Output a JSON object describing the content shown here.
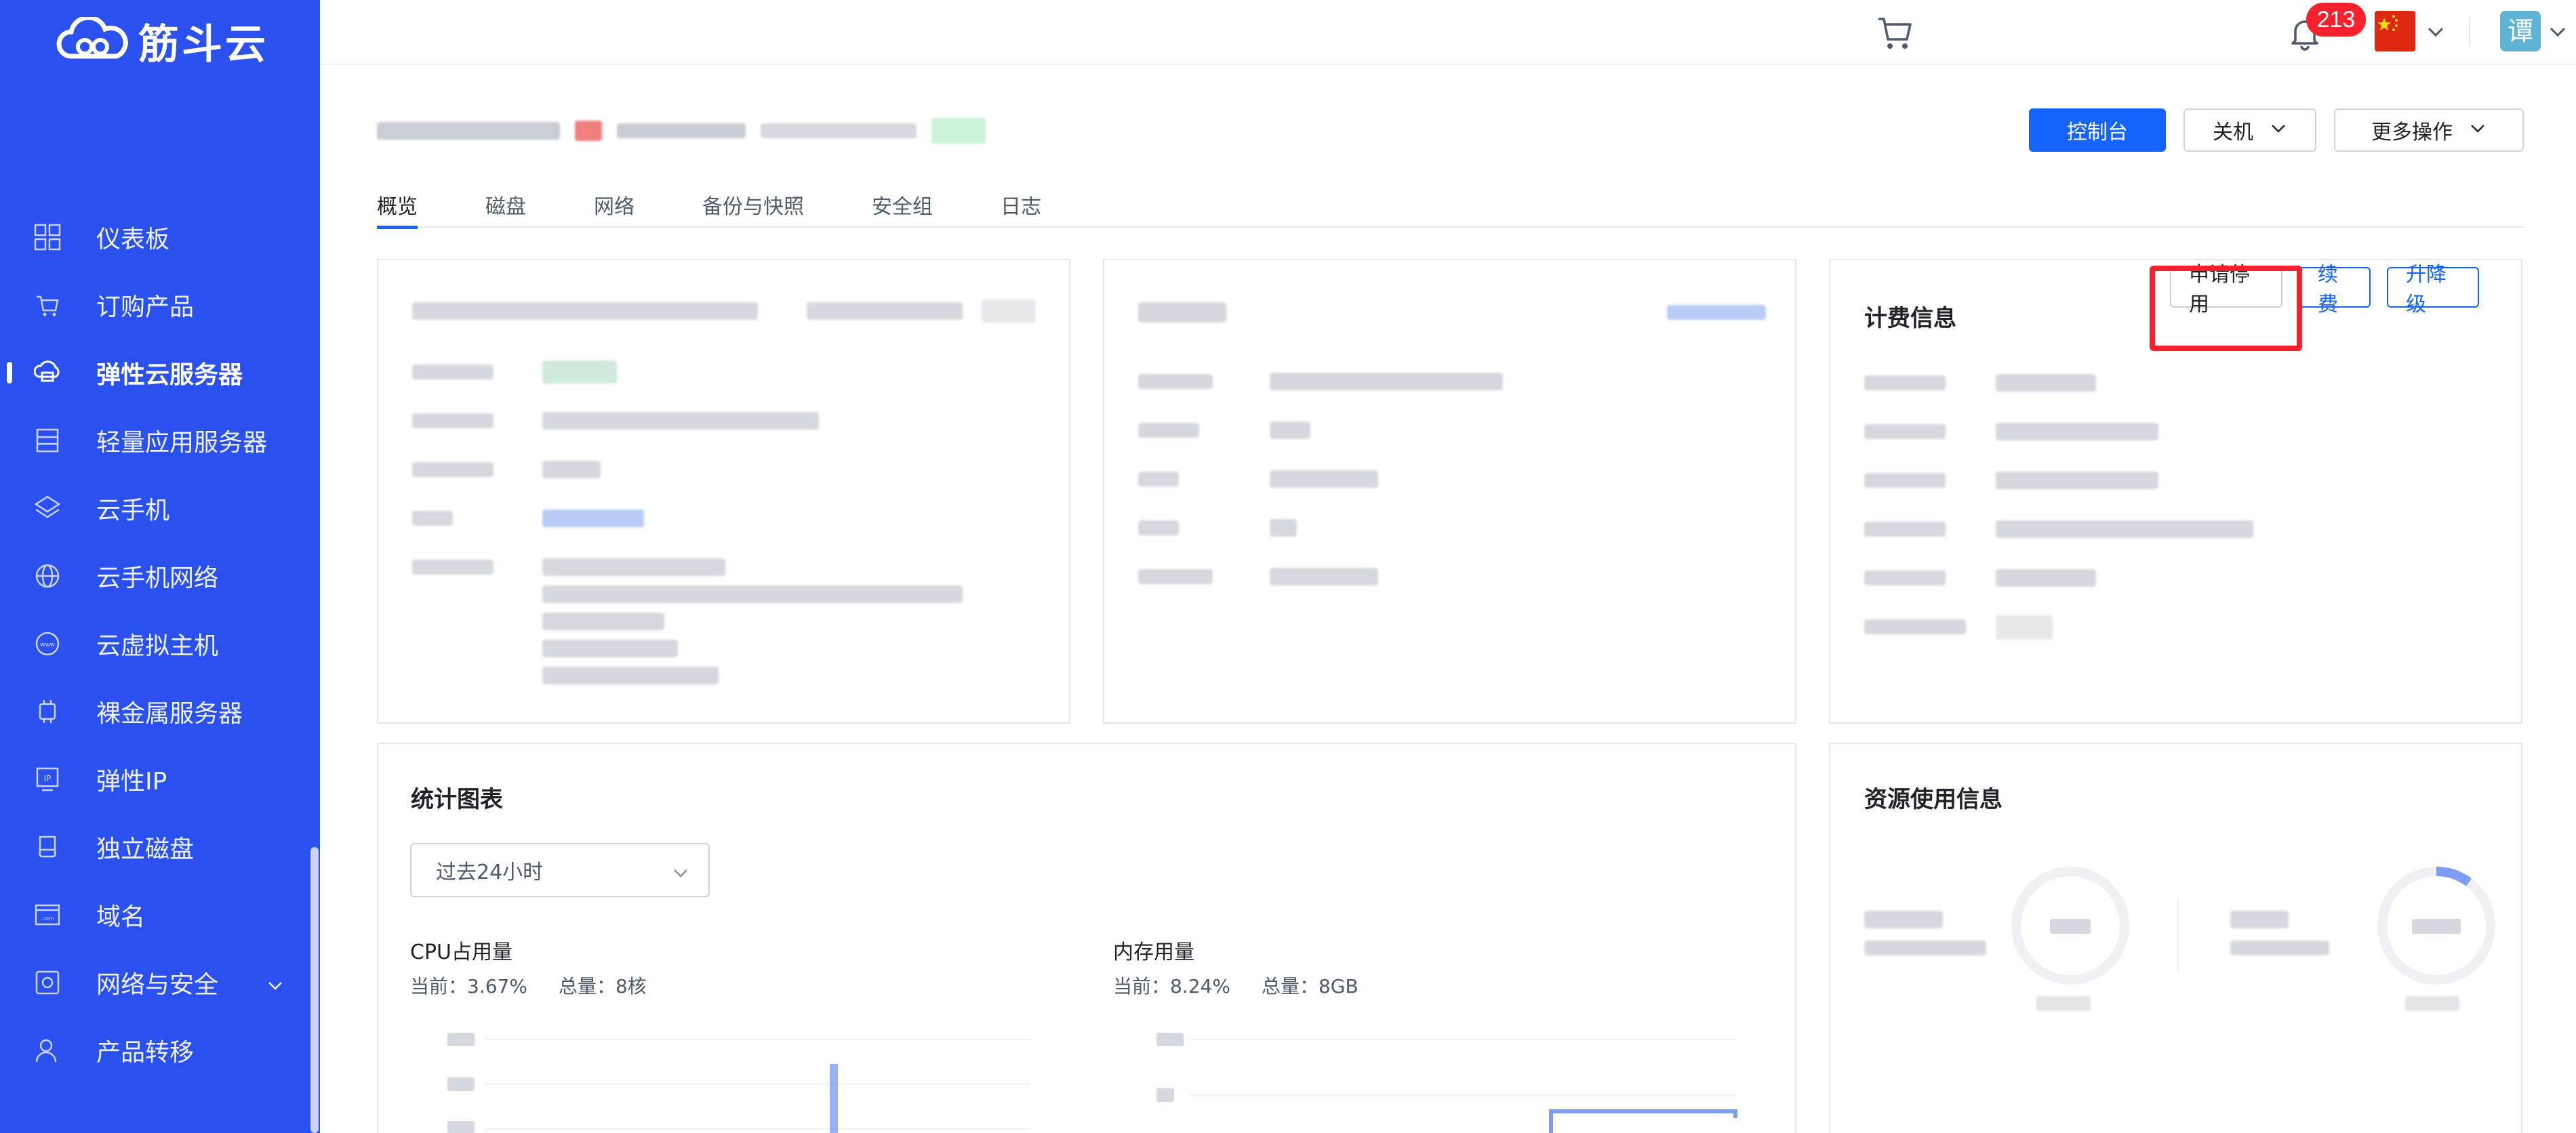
{
  "brand": {
    "name": "筋斗云"
  },
  "sidebar": {
    "items": [
      {
        "label": "仪表板",
        "icon": "grid-icon"
      },
      {
        "label": "订购产品",
        "icon": "cart-icon"
      },
      {
        "label": "弹性云服务器",
        "icon": "cloud-server-icon",
        "active": true
      },
      {
        "label": "轻量应用服务器",
        "icon": "server-icon"
      },
      {
        "label": "云手机",
        "icon": "phone-icon"
      },
      {
        "label": "云手机网络",
        "icon": "globe-icon"
      },
      {
        "label": "云虚拟主机",
        "icon": "www-icon"
      },
      {
        "label": "裸金属服务器",
        "icon": "chip-icon"
      },
      {
        "label": "弹性IP",
        "icon": "ip-icon"
      },
      {
        "label": "独立磁盘",
        "icon": "disk-icon"
      },
      {
        "label": "域名",
        "icon": "domain-icon"
      },
      {
        "label": "网络与安全",
        "icon": "network-security-icon",
        "expandable": true
      },
      {
        "label": "产品转移",
        "icon": "user-transfer-icon"
      }
    ]
  },
  "topbar": {
    "notifications_count": "213",
    "avatar_text": "谭"
  },
  "header": {
    "actions": {
      "console": "控制台",
      "power": "关机",
      "more": "更多操作"
    }
  },
  "tabs": [
    "概览",
    "磁盘",
    "网络",
    "备份与快照",
    "安全组",
    "日志"
  ],
  "billing": {
    "title": "计费信息",
    "request_stop": "申请停用",
    "renew": "续费",
    "upgrade": "升降级"
  },
  "stats": {
    "title": "统计图表",
    "range": "过去24小时",
    "cpu": {
      "title": "CPU占用量",
      "current": "当前：3.67%",
      "total": "总量：8核"
    },
    "mem": {
      "title": "内存用量",
      "current": "当前：8.24%",
      "total": "总量：8GB"
    }
  },
  "resource": {
    "title": "资源使用信息"
  },
  "colors": {
    "sidebar": "#2b50f0",
    "primary": "#1664ff",
    "badge": "#f5222d",
    "highlight": "#f5222d"
  }
}
